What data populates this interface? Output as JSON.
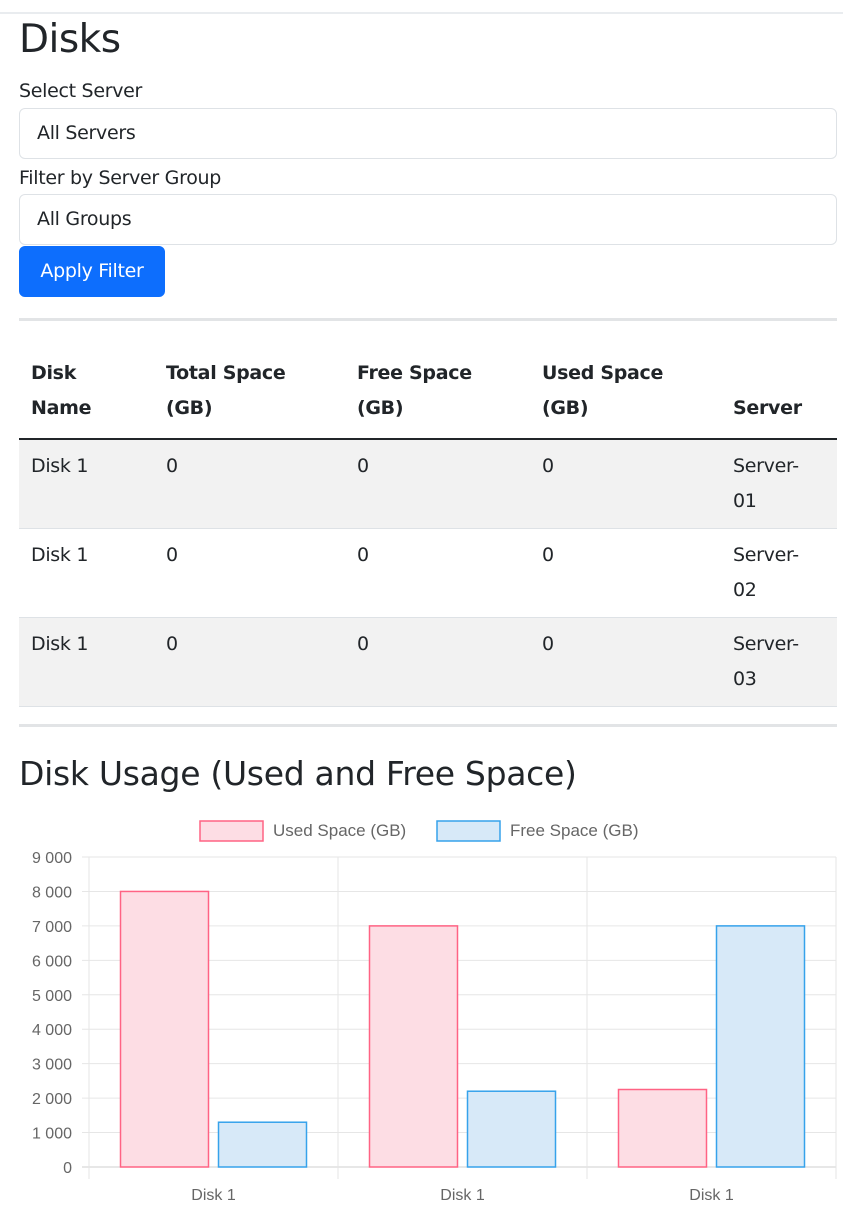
{
  "page_title": "Disks",
  "filters": {
    "server_label": "Select Server",
    "server_value": "All Servers",
    "group_label": "Filter by Server Group",
    "group_value": "All Groups",
    "apply_label": "Apply Filter"
  },
  "table": {
    "headers": [
      [
        "Disk",
        "Name"
      ],
      [
        "Total Space",
        "(GB)"
      ],
      [
        "Free Space",
        "(GB)"
      ],
      [
        "Used Space",
        "(GB)"
      ],
      [
        "",
        "Server"
      ]
    ],
    "rows": [
      {
        "disk": "Disk 1",
        "total": "0",
        "free": "0",
        "used": "0",
        "server": [
          "Server-",
          "01"
        ]
      },
      {
        "disk": "Disk 1",
        "total": "0",
        "free": "0",
        "used": "0",
        "server": [
          "Server-",
          "02"
        ]
      },
      {
        "disk": "Disk 1",
        "total": "0",
        "free": "0",
        "used": "0",
        "server": [
          "Server-",
          "03"
        ]
      }
    ]
  },
  "chart_title": "Disk Usage (Used and Free Space)",
  "colors": {
    "used_fill": "#fddde4",
    "used_border": "#ff6384",
    "free_fill": "#d7e9f8",
    "free_border": "#36a2eb",
    "primary": "#0d6efd"
  },
  "chart_data": {
    "type": "bar",
    "categories": [
      "Disk 1",
      "Disk 1",
      "Disk 1"
    ],
    "series": [
      {
        "name": "Used Space (GB)",
        "values": [
          8000,
          7000,
          2250
        ]
      },
      {
        "name": "Free Space (GB)",
        "values": [
          1300,
          2200,
          7000
        ]
      }
    ],
    "yticks": [
      "0",
      "1 000",
      "2 000",
      "3 000",
      "4 000",
      "5 000",
      "6 000",
      "7 000",
      "8 000",
      "9 000"
    ],
    "ylim": [
      0,
      9000
    ],
    "grid": true,
    "legend": "top-center"
  }
}
